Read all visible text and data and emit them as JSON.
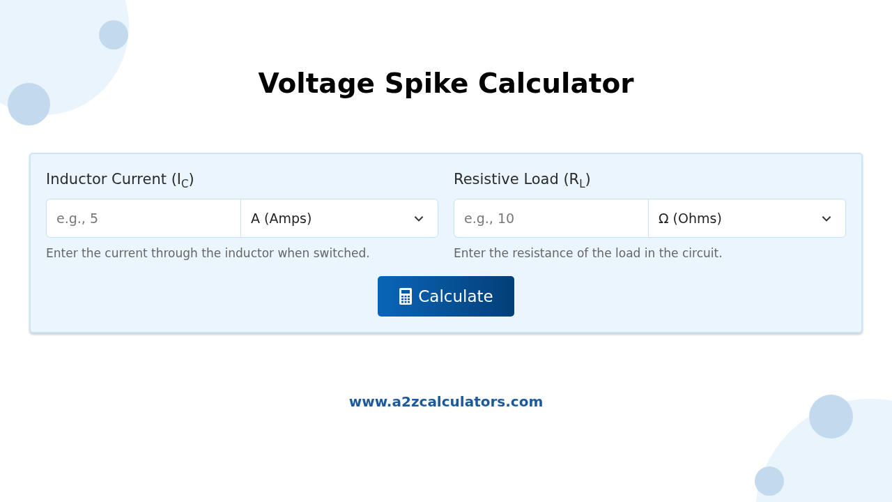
{
  "title": "Voltage Spike Calculator",
  "fields": [
    {
      "label": "Inductor Current (I$_{C}$)",
      "placeholder": "e.g., 5",
      "unit": "A (Amps)",
      "help": "Enter the current through the inductor when switched."
    },
    {
      "label": "Resistive Load (R$_{L}$)",
      "placeholder": "e.g., 10",
      "unit": "Ω (Ohms)",
      "help": "Enter the resistance of the load in the circuit."
    }
  ],
  "button": {
    "label": "Calculate"
  },
  "footer": {
    "link": "www.a2zcalculators.com"
  }
}
